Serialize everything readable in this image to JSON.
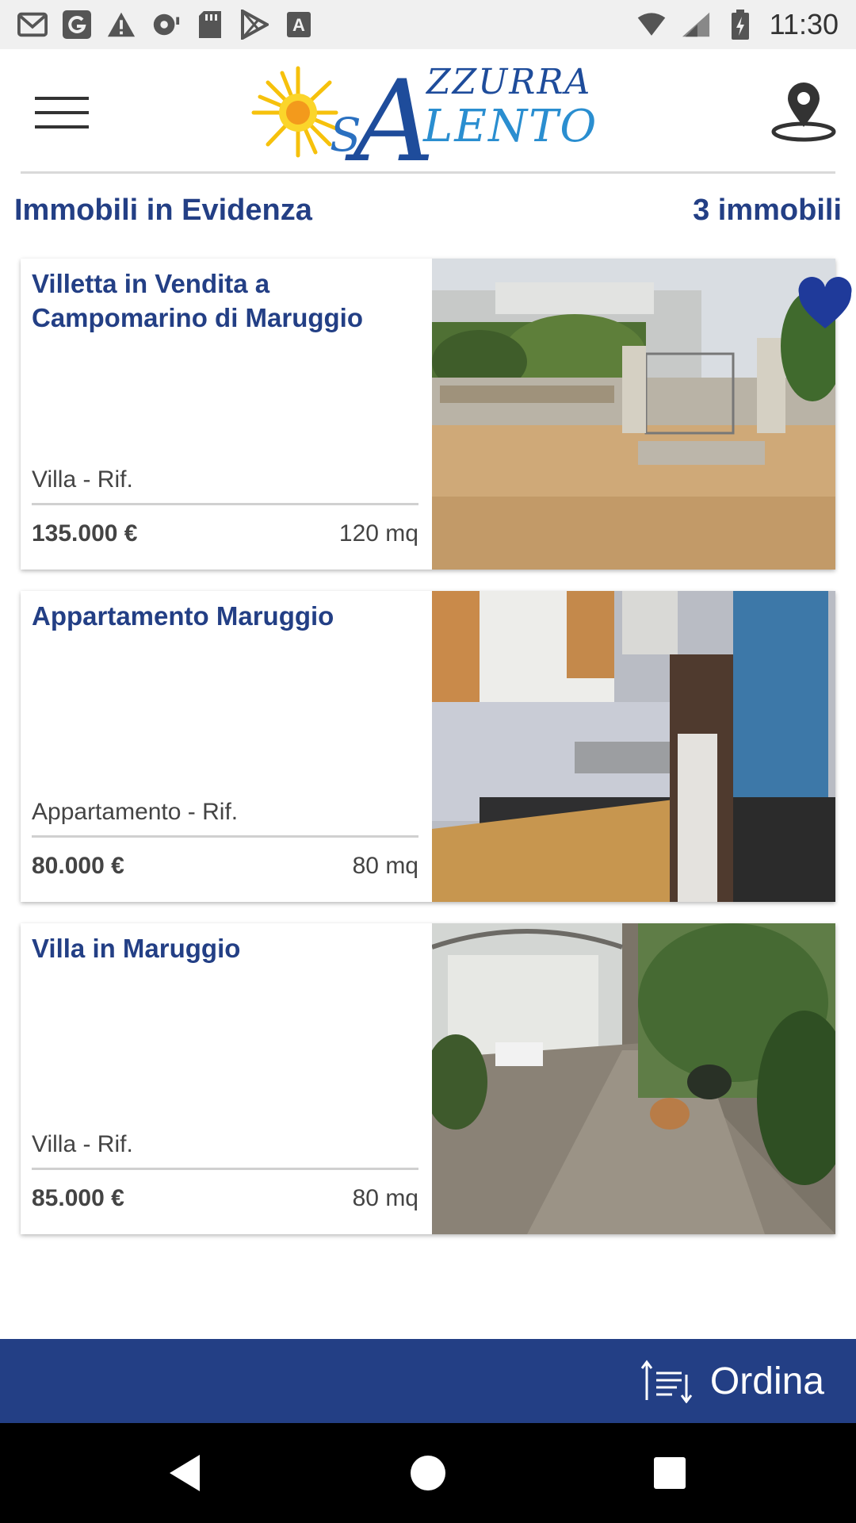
{
  "status_bar": {
    "time": "11:30",
    "left_icons": [
      "gmail-icon",
      "google-icon",
      "warning-icon",
      "podcast-icon",
      "sd-card-icon",
      "play-store-icon",
      "font-a-icon"
    ],
    "right_icons": [
      "wifi-icon",
      "signal-icon",
      "battery-charging-icon"
    ]
  },
  "header": {
    "logo": {
      "text_top": "ZZURRA",
      "text_big_letter": "A",
      "text_bottom": "LENTO",
      "text_s": "S"
    },
    "menu_icon": "hamburger-menu-icon",
    "location_icon": "map-pin-icon"
  },
  "section": {
    "title": "Immobili in Evidenza",
    "count": "3 immobili"
  },
  "listings": [
    {
      "title": "Villetta in Vendita a Campomarino di Maruggio",
      "type": "Villa - Rif.",
      "price": "135.000 €",
      "area": "120 mq",
      "favorite": true
    },
    {
      "title": "Appartamento Maruggio",
      "type": "Appartamento - Rif.",
      "price": "80.000 €",
      "area": "80 mq",
      "favorite": false
    },
    {
      "title": "Villa in Maruggio",
      "type": "Villa - Rif.",
      "price": "85.000 €",
      "area": "80 mq",
      "favorite": false
    }
  ],
  "sort_bar": {
    "label": "Ordina",
    "icon": "sort-icon"
  },
  "nav_bar": {
    "buttons": [
      "back-icon",
      "home-icon",
      "recents-icon"
    ]
  },
  "colors": {
    "brand_blue": "#233f85",
    "heart_blue": "#1f3a9a",
    "logo_sun": "#f6c10c",
    "logo_text": "#1e4c9b"
  }
}
